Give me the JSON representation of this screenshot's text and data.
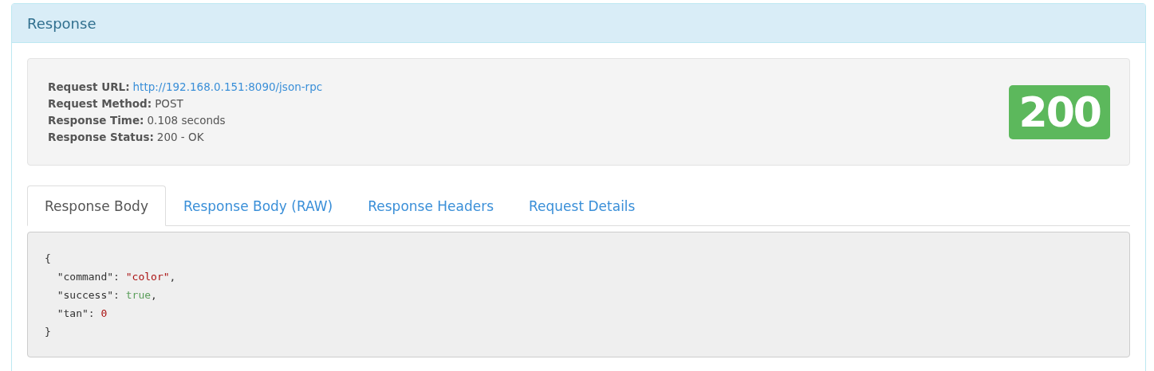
{
  "panel": {
    "title": "Response"
  },
  "summary": {
    "fields": [
      {
        "label": "Request URL:",
        "value": "http://192.168.0.151:8090/json-rpc",
        "kind": "link"
      },
      {
        "label": "Request Method:",
        "value": "POST",
        "kind": "text"
      },
      {
        "label": "Response Time:",
        "value": "0.108 seconds",
        "kind": "text"
      },
      {
        "label": "Response Status:",
        "value": "200 - OK",
        "kind": "text"
      }
    ],
    "status_badge": "200"
  },
  "tabs": [
    {
      "label": "Response Body",
      "selected": true
    },
    {
      "label": "Response Body (RAW)",
      "selected": false
    },
    {
      "label": "Response Headers",
      "selected": false
    },
    {
      "label": "Request Details",
      "selected": false
    }
  ],
  "body_lines": [
    [
      {
        "text": "{",
        "kind": "punct"
      }
    ],
    [
      {
        "text": "  \"command\": ",
        "kind": "key"
      },
      {
        "text": "\"color\"",
        "kind": "string"
      },
      {
        "text": ",",
        "kind": "punct"
      }
    ],
    [
      {
        "text": "  \"success\": ",
        "kind": "key"
      },
      {
        "text": "true",
        "kind": "bool"
      },
      {
        "text": ",",
        "kind": "punct"
      }
    ],
    [
      {
        "text": "  \"tan\": ",
        "kind": "key"
      },
      {
        "text": "0",
        "kind": "number"
      }
    ],
    [
      {
        "text": "}",
        "kind": "punct"
      }
    ]
  ]
}
